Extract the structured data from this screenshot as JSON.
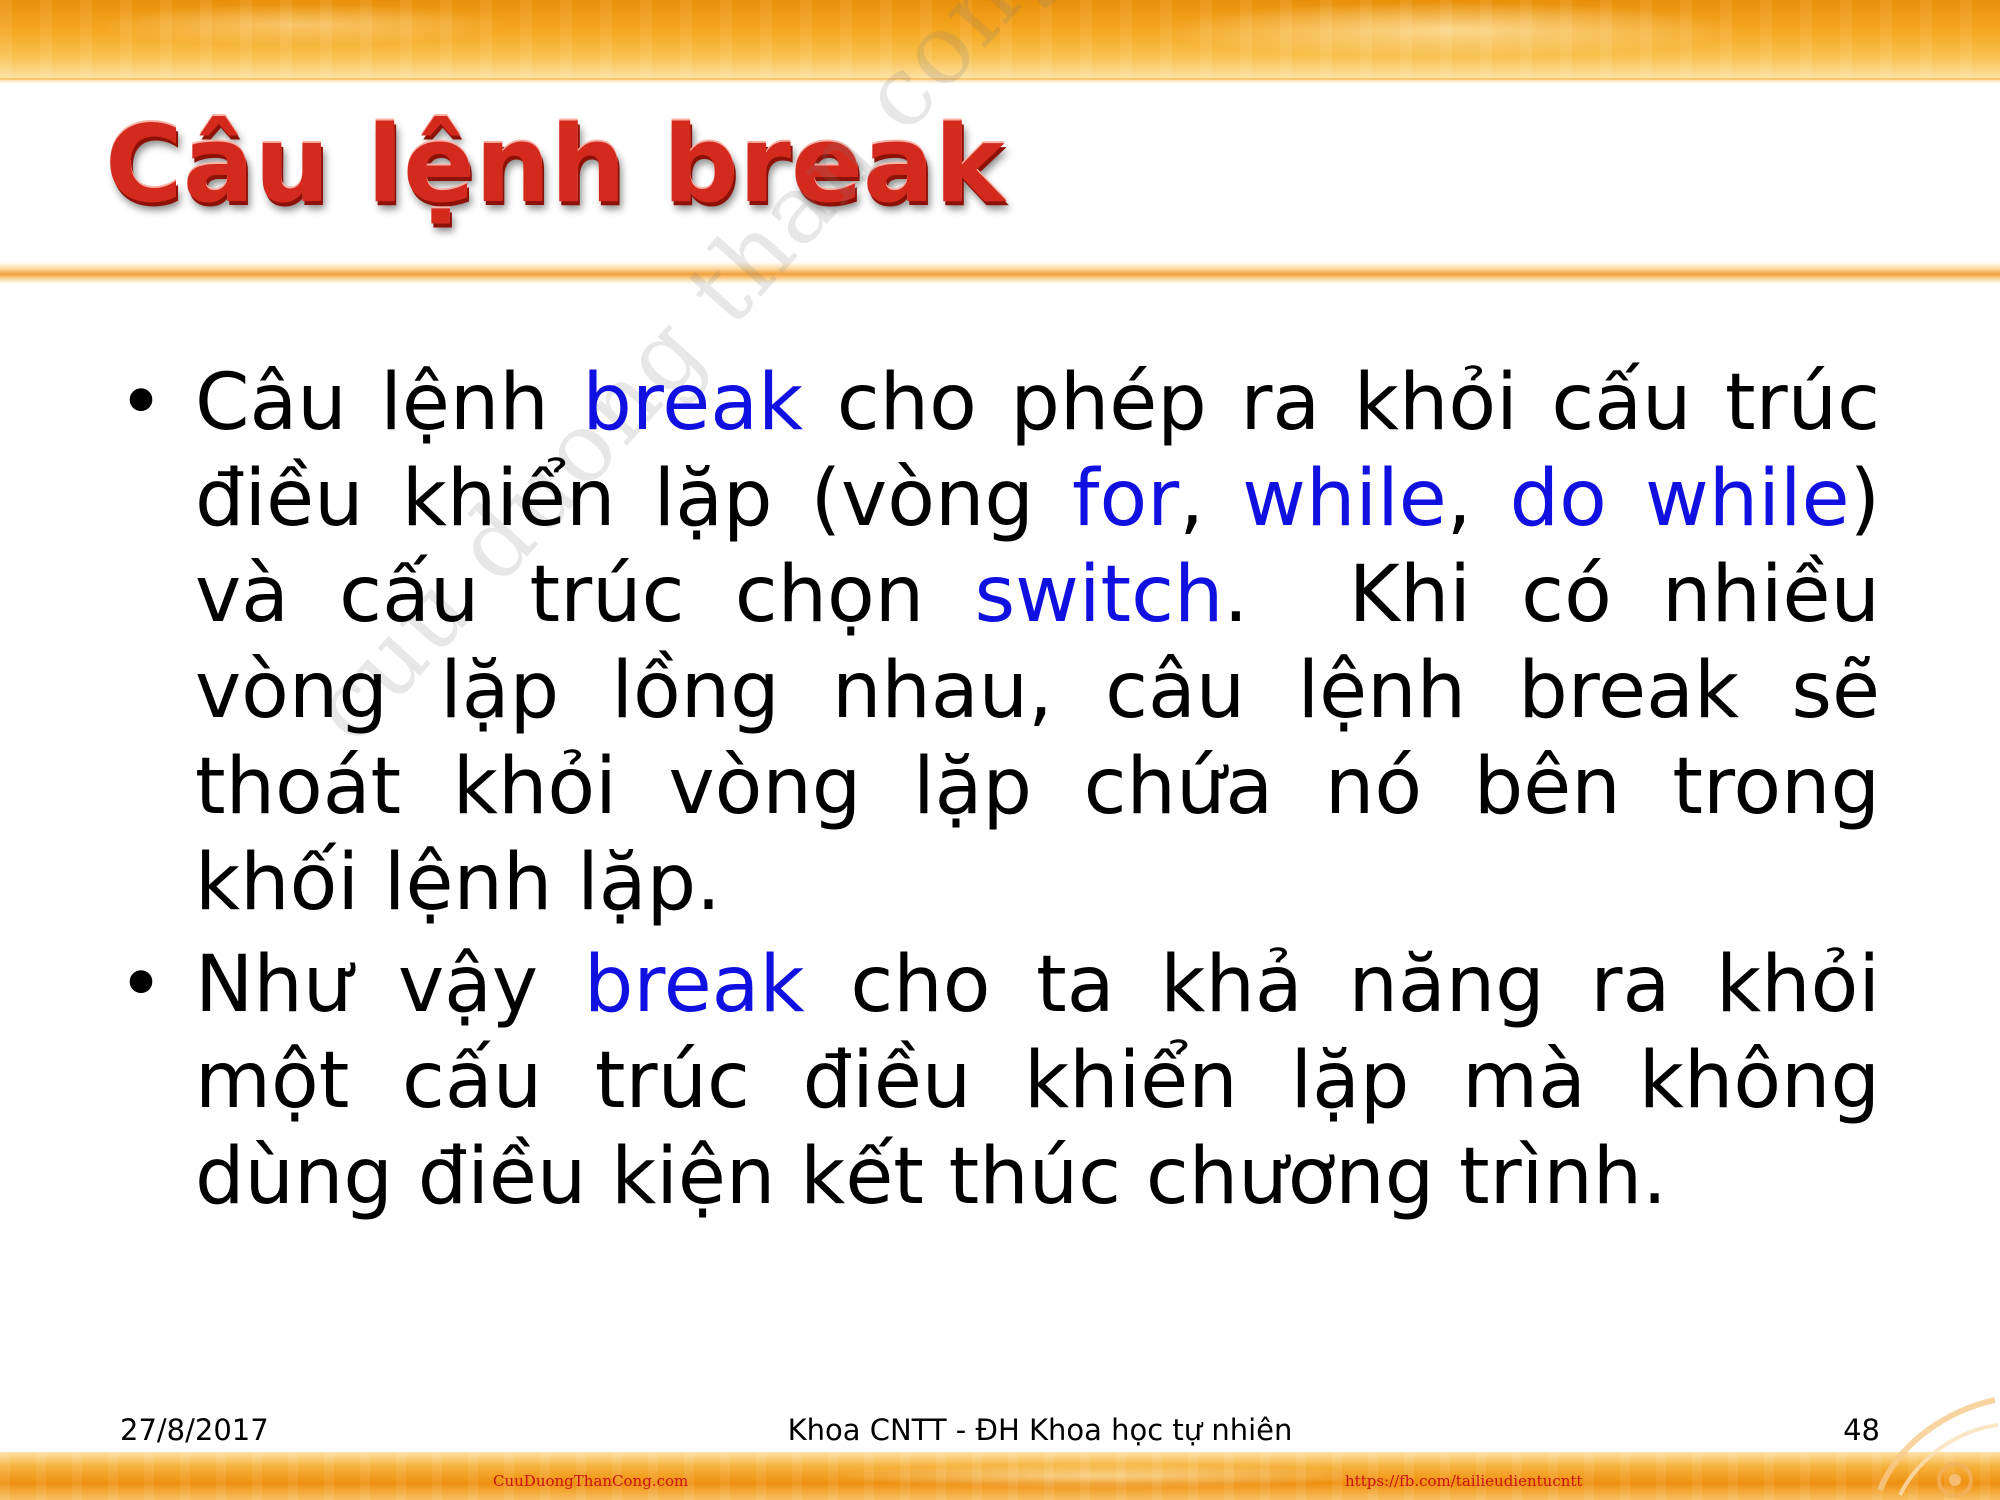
{
  "slide": {
    "title": "Câu lệnh break",
    "bullets": [
      {
        "runs": [
          {
            "text": "Câu lệnh ",
            "kw": false
          },
          {
            "text": "break",
            "kw": true
          },
          {
            "text": " cho phép ra khỏi cấu trúc điều khiển lặp (vòng ",
            "kw": false
          },
          {
            "text": "for",
            "kw": true
          },
          {
            "text": ", ",
            "kw": false
          },
          {
            "text": "while",
            "kw": true
          },
          {
            "text": ", ",
            "kw": false
          },
          {
            "text": "do while",
            "kw": true
          },
          {
            "text": ") và cấu trúc chọn ",
            "kw": false
          },
          {
            "text": "switch",
            "kw": true
          },
          {
            "text": ".  Khi có nhiều vòng lặp lồng nhau, câu lệnh break sẽ thoát khỏi vòng lặp chứa nó bên trong khối lệnh lặp.",
            "kw": false
          }
        ]
      },
      {
        "runs": [
          {
            "text": "Như vậy ",
            "kw": false
          },
          {
            "text": "break",
            "kw": true
          },
          {
            "text": " cho ta khả năng ra khỏi một cấu trúc điều khiển lặp mà không dùng điều kiện kết thúc chương trình.",
            "kw": false
          }
        ]
      }
    ],
    "bullet_symbol": "•",
    "watermark": "cuu duong than cong . com"
  },
  "footer": {
    "date": "27/8/2017",
    "center": "Khoa CNTT - ĐH Khoa học tự nhiên",
    "page": "48",
    "link_left": "CuuDuongThanCong.com",
    "link_right": "https://fb.com/tailieudientucntt"
  },
  "colors": {
    "title": "#d42a1e",
    "keyword": "#1010e0",
    "band": "#f4a41e"
  }
}
